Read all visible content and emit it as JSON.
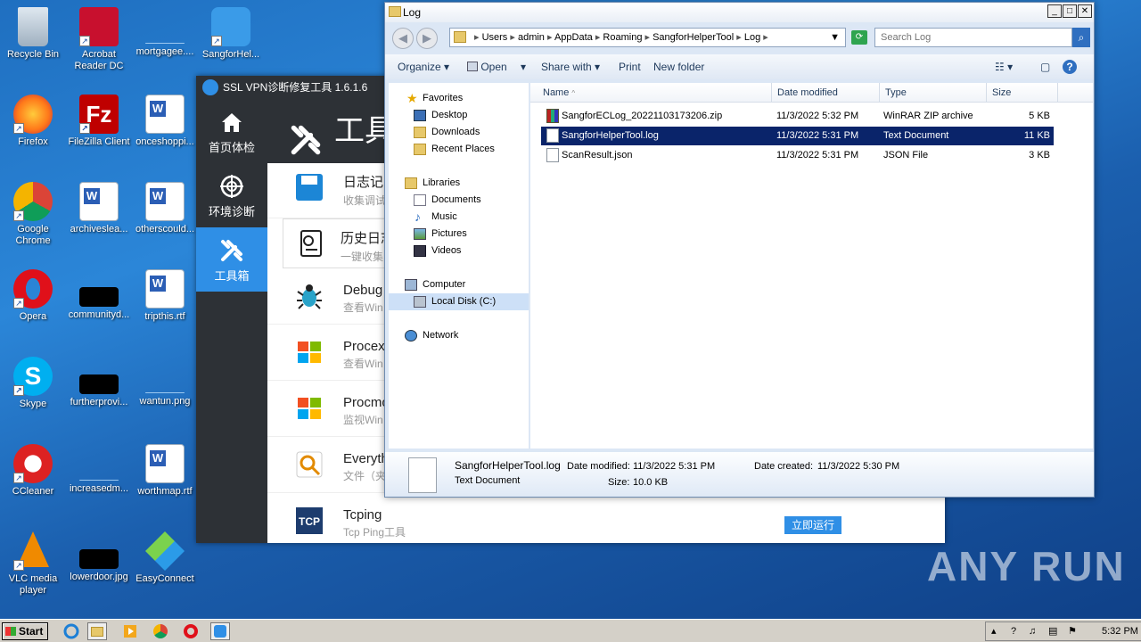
{
  "desktop": {
    "icons": [
      {
        "label": "Recycle Bin",
        "icon": "recycle-bin-icon"
      },
      {
        "label": "Acrobat Reader DC",
        "icon": "acrobat-icon"
      },
      {
        "label": "mortgagee....",
        "icon": "image-icon"
      },
      {
        "label": "SangforHel...",
        "icon": "sangfor-icon"
      },
      {
        "label": "Firefox",
        "icon": "firefox-icon"
      },
      {
        "label": "FileZilla Client",
        "icon": "filezilla-icon"
      },
      {
        "label": "onceshoppi...",
        "icon": "word-doc-icon"
      },
      {
        "label": "Google Chrome",
        "icon": "chrome-icon"
      },
      {
        "label": "archiveslea...",
        "icon": "word-doc-icon"
      },
      {
        "label": "otherscould...",
        "icon": "word-doc-icon"
      },
      {
        "label": "Opera",
        "icon": "opera-icon"
      },
      {
        "label": "communityd...",
        "icon": "image-icon"
      },
      {
        "label": "tripthis.rtf",
        "icon": "word-doc-icon"
      },
      {
        "label": "Skype",
        "icon": "skype-icon"
      },
      {
        "label": "furtherprovi...",
        "icon": "image-icon"
      },
      {
        "label": "wantun.png",
        "icon": "image-icon"
      },
      {
        "label": "CCleaner",
        "icon": "ccleaner-icon"
      },
      {
        "label": "increasedm...",
        "icon": "image-icon"
      },
      {
        "label": "worthmap.rtf",
        "icon": "word-doc-icon"
      },
      {
        "label": "VLC media player",
        "icon": "vlc-icon"
      },
      {
        "label": "lowerdoor.jpg",
        "icon": "image-icon"
      },
      {
        "label": "EasyConnect",
        "icon": "easyconnect-icon"
      }
    ]
  },
  "vpn_tool": {
    "title": "SSL VPN诊断修复工具 1.6.1.6",
    "nav": [
      {
        "label": "首页体检"
      },
      {
        "label": "环境诊断"
      },
      {
        "label": "工具箱"
      }
    ],
    "header_title": "工具",
    "tools": [
      {
        "name": "日志记录",
        "desc": "收集调试"
      },
      {
        "name": "历史日志",
        "desc": "一键收集"
      },
      {
        "name": "Debug",
        "desc": "查看Win"
      },
      {
        "name": "Procex",
        "desc": "查看Win"
      },
      {
        "name": "Procmo",
        "desc": "监视Win"
      },
      {
        "name": "Everyth",
        "desc": "文件（夹"
      },
      {
        "name": "Tcping",
        "desc": "Tcp Ping工具"
      }
    ],
    "run_button": "立即运行"
  },
  "explorer": {
    "title": "Log",
    "breadcrumb": [
      "Users",
      "admin",
      "AppData",
      "Roaming",
      "SangforHelperTool",
      "Log"
    ],
    "search_placeholder": "Search Log",
    "toolbar": {
      "organize": "Organize",
      "open": "Open",
      "share_with": "Share with",
      "print": "Print",
      "new_folder": "New folder"
    },
    "nav": {
      "favorites": "Favorites",
      "desktop": "Desktop",
      "downloads": "Downloads",
      "recent_places": "Recent Places",
      "libraries": "Libraries",
      "documents": "Documents",
      "music": "Music",
      "pictures": "Pictures",
      "videos": "Videos",
      "computer": "Computer",
      "local_disk": "Local Disk (C:)",
      "network": "Network"
    },
    "columns": {
      "name": "Name",
      "date": "Date modified",
      "type": "Type",
      "size": "Size"
    },
    "files": [
      {
        "name": "SangforECLog_20221103173206.zip",
        "date": "11/3/2022 5:32 PM",
        "type": "WinRAR ZIP archive",
        "size": "5 KB"
      },
      {
        "name": "SangforHelperTool.log",
        "date": "11/3/2022 5:31 PM",
        "type": "Text Document",
        "size": "11 KB"
      },
      {
        "name": "ScanResult.json",
        "date": "11/3/2022 5:31 PM",
        "type": "JSON File",
        "size": "3 KB"
      }
    ],
    "details": {
      "filename": "SangforHelperTool.log",
      "type": "Text Document",
      "modified_label": "Date modified:",
      "modified": "11/3/2022 5:31 PM",
      "created_label": "Date created:",
      "created": "11/3/2022 5:30 PM",
      "size_label": "Size:",
      "size": "10.0 KB"
    }
  },
  "taskbar": {
    "start": "Start",
    "clock": "5:32 PM"
  },
  "watermark": "ANY RUN",
  "colors": {
    "accent": "#2f8fe6",
    "selection": "#0a246a",
    "vpn_dark": "#2d3136"
  }
}
